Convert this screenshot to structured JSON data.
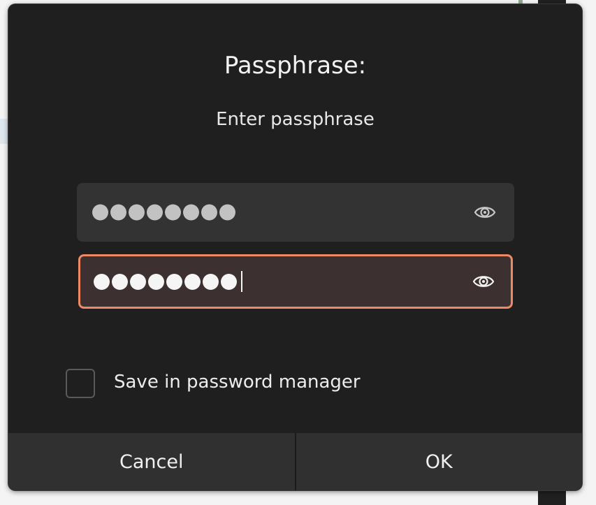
{
  "dialog": {
    "title": "Passphrase:",
    "prompt": "Enter passphrase",
    "passphrase_field": {
      "masked_length": 8,
      "reveal_icon": "eye-icon"
    },
    "confirm_field": {
      "masked_length": 8,
      "focused": true,
      "reveal_icon": "eye-icon"
    },
    "save_checkbox": {
      "label": "Save in password manager",
      "checked": false
    },
    "buttons": {
      "cancel_label": "Cancel",
      "ok_label": "OK"
    }
  },
  "colors": {
    "dialog_bg": "#1f1f1f",
    "field_bg": "#333333",
    "focused_field_bg": "#3c3130",
    "focus_border": "#ee8966",
    "button_bg": "#303030"
  }
}
